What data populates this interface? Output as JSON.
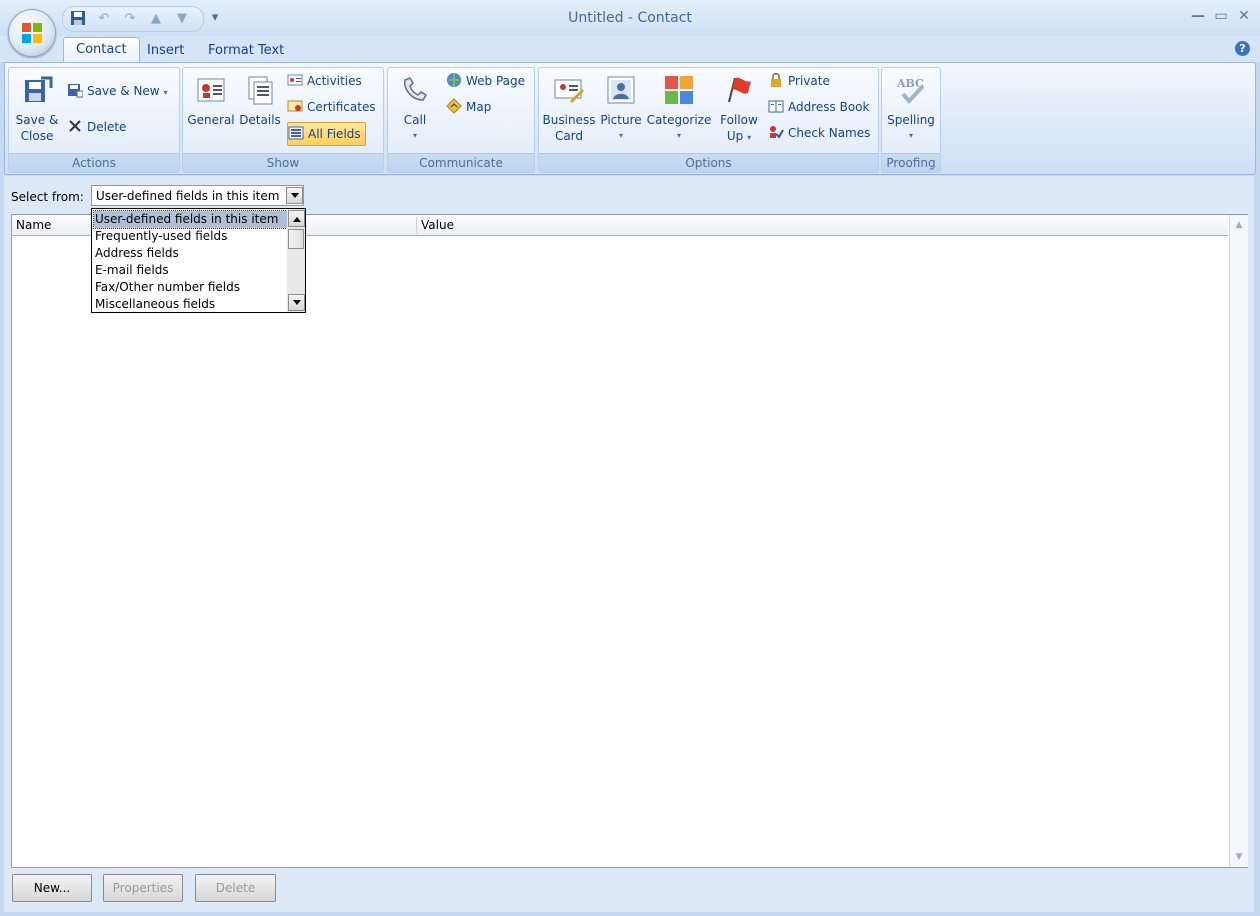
{
  "window": {
    "title_doc": "Untitled",
    "title_sep": " - ",
    "title_app": "Contact",
    "minimize": "—",
    "maximize": "▭",
    "close": "✕"
  },
  "tabs": [
    {
      "label": "Contact",
      "active": true
    },
    {
      "label": "Insert",
      "active": false
    },
    {
      "label": "Format Text",
      "active": false
    }
  ],
  "help_glyph": "?",
  "ribbon": {
    "actions": {
      "label": "Actions",
      "save_close": "Save &",
      "save_close2": "Close",
      "save_new": "Save & New",
      "delete": "Delete"
    },
    "show": {
      "label": "Show",
      "general": "General",
      "details": "Details",
      "activities": "Activities",
      "certificates": "Certificates",
      "all_fields": "All Fields"
    },
    "communicate": {
      "label": "Communicate",
      "call": "Call",
      "web_page": "Web Page",
      "map": "Map"
    },
    "options": {
      "label": "Options",
      "business_card": "Business",
      "business_card2": "Card",
      "picture": "Picture",
      "categorize": "Categorize",
      "follow_up": "Follow",
      "follow_up2": "Up",
      "private": "Private",
      "address_book": "Address Book",
      "check_names": "Check Names"
    },
    "proofing": {
      "label": "Proofing",
      "spelling": "Spelling",
      "spelling_icon_text": "ABC"
    }
  },
  "select_from": {
    "label": "Select from:",
    "value": "User-defined fields in this item",
    "options": [
      "User-defined fields in this item",
      "Frequently-used fields",
      "Address fields",
      "E-mail fields",
      "Fax/Other number fields",
      "Miscellaneous fields"
    ]
  },
  "table": {
    "columns": [
      "Name",
      "Value"
    ]
  },
  "buttons": {
    "new": "New...",
    "properties": "Properties",
    "delete": "Delete"
  },
  "colors": {
    "accent": "#15428b",
    "selected_button": "#ffcf5a",
    "frame": "#c5daf2"
  }
}
